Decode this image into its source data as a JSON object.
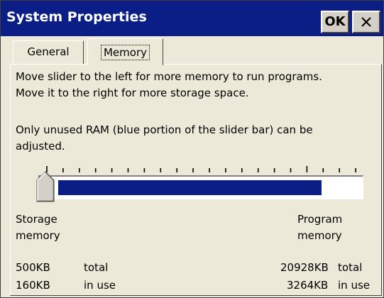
{
  "window": {
    "title": "System Properties",
    "ok_label": "OK"
  },
  "tabs": [
    {
      "label": "General",
      "selected": false
    },
    {
      "label": "Memory",
      "selected": true
    }
  ],
  "memory": {
    "instructions_line1": "Move slider to the left for more memory to run programs.",
    "instructions_line2": "Move it to the right for more storage space.",
    "note_line1": "Only unused RAM (blue portion of the slider bar) can be",
    "note_line2": "adjusted.",
    "slider": {
      "program_fraction": 0.87
    },
    "storage_label_line1": "Storage",
    "storage_label_line2": "memory",
    "program_label_line1": "Program",
    "program_label_line2": "memory",
    "storage_total_value": "500KB",
    "storage_total_label": "total",
    "storage_inuse_value": "160KB",
    "storage_inuse_label": "in use",
    "program_total_value": "20928KB",
    "program_total_label": "total",
    "program_inuse_value": "3264KB",
    "program_inuse_label": "in use"
  },
  "colors": {
    "titlebar": "#0a1e86",
    "slider_fill": "#0a1e86",
    "face": "#ece9d8"
  },
  "icons": {
    "close": "close-icon"
  }
}
